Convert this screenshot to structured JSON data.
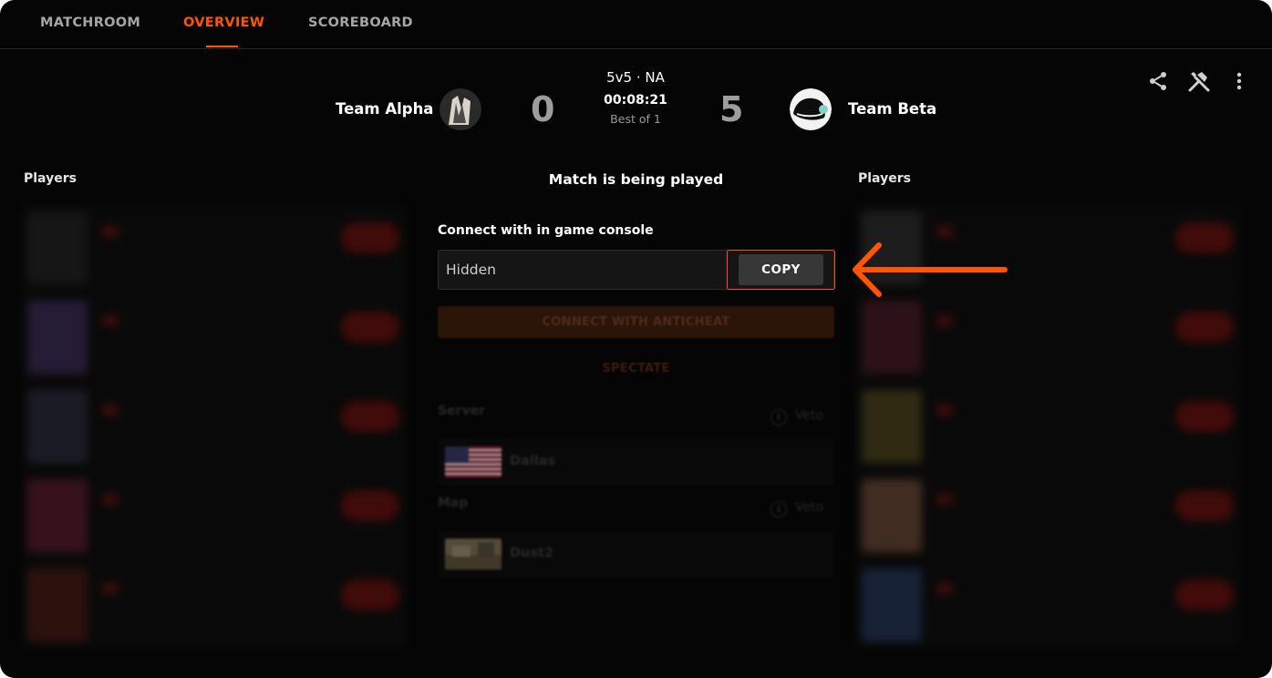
{
  "tabs": [
    {
      "label": "MATCHROOM",
      "active": false
    },
    {
      "label": "OVERVIEW",
      "active": true
    },
    {
      "label": "SCOREBOARD",
      "active": false
    }
  ],
  "match": {
    "team_left": {
      "name": "Team Alpha",
      "score": "0"
    },
    "team_right": {
      "name": "Team Beta",
      "score": "5"
    },
    "mode": "5v5 · NA",
    "timer": "00:08:21",
    "best_of": "Best of 1"
  },
  "header_icons": [
    "share-icon",
    "tools-icon",
    "more-vertical-icon"
  ],
  "players_left": {
    "title": "Players"
  },
  "players_right": {
    "title": "Players"
  },
  "center": {
    "status": "Match is being played",
    "console_label": "Connect with in game console",
    "connect_value": "Hidden",
    "copy_label": "COPY",
    "anticheat_label": "CONNECT WITH ANTICHEAT",
    "spectate_label": "SPECTATE",
    "server_label": "Server",
    "server_value": "Dallas",
    "map_label": "Map",
    "map_value": "Dust2",
    "veto_label": "Veto"
  },
  "colors": {
    "accent": "#ff5500",
    "background": "#050505",
    "annotation_arrow": "#ff5500"
  }
}
